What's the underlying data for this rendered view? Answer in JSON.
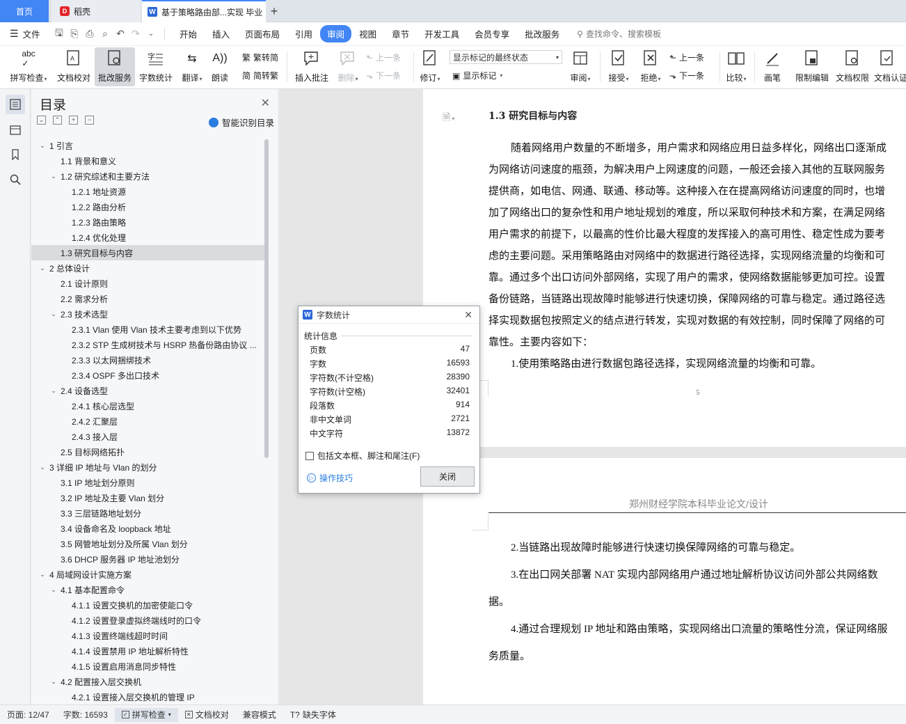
{
  "tabs": {
    "home": "首页",
    "daoke": "稻壳",
    "doc": "基于策略路由部...实现 毕业论"
  },
  "menubar": {
    "file": "文件",
    "items": [
      "开始",
      "插入",
      "页面布局",
      "引用",
      "审阅",
      "视图",
      "章节",
      "开发工具",
      "会员专享",
      "批改服务"
    ],
    "active": "审阅",
    "search": "查找命令、搜索模板"
  },
  "ribbon": {
    "spell": "拼写检查",
    "proofread": "文档校对",
    "revise_service": "批改服务",
    "word_count": "字数统计",
    "translate": "翻译",
    "read_aloud": "朗读",
    "to_traditional": "繁转简",
    "to_simplified": "简转繁",
    "insert_comment": "插入批注",
    "delete": "删除",
    "prev": "上一条",
    "next": "下一条",
    "revise": "修订",
    "markup_state": "显示标记的最终状态",
    "show_markup": "显示标记",
    "review": "审阅",
    "accept": "接受",
    "reject": "拒绝",
    "prev2": "上一条",
    "next2": "下一条",
    "compare": "比较",
    "pen": "画笔",
    "restrict_edit": "限制编辑",
    "doc_permission": "文档权限",
    "doc_auth": "文档认证"
  },
  "toc": {
    "title": "目录",
    "smart": "智能识别目录",
    "items": [
      {
        "level": 1,
        "text": "1 引言",
        "toggle": "v"
      },
      {
        "level": 2,
        "text": "1.1 背景和意义",
        "toggle": ""
      },
      {
        "level": 2,
        "text": "1.2 研究综述和主要方法",
        "toggle": "v"
      },
      {
        "level": 3,
        "text": "1.2.1 地址资源",
        "toggle": ""
      },
      {
        "level": 3,
        "text": "1.2.2 路由分析",
        "toggle": ""
      },
      {
        "level": 3,
        "text": "1.2.3 路由策略",
        "toggle": ""
      },
      {
        "level": 3,
        "text": "1.2.4 优化处理",
        "toggle": ""
      },
      {
        "level": 2,
        "text": "1.3 研究目标与内容",
        "toggle": "",
        "selected": true
      },
      {
        "level": 1,
        "text": "2 总体设计",
        "toggle": "v"
      },
      {
        "level": 2,
        "text": "2.1 设计原则",
        "toggle": ""
      },
      {
        "level": 2,
        "text": "2.2 需求分析",
        "toggle": ""
      },
      {
        "level": 2,
        "text": "2.3 技术选型",
        "toggle": "v"
      },
      {
        "level": 3,
        "text": "2.3.1 Vlan  使用 Vlan 技术主要考虑到以下优势",
        "toggle": ""
      },
      {
        "level": 3,
        "text": "2.3.2 STP 生成树技术与 HSRP 热备份路由协议 ...",
        "toggle": ""
      },
      {
        "level": 3,
        "text": "2.3.3 以太网捆绑技术",
        "toggle": ""
      },
      {
        "level": 3,
        "text": "2.3.4 OSPF 多出口技术",
        "toggle": ""
      },
      {
        "level": 2,
        "text": "2.4 设备选型",
        "toggle": "v"
      },
      {
        "level": 3,
        "text": "2.4.1 核心层选型",
        "toggle": ""
      },
      {
        "level": 3,
        "text": "2.4.2 汇聚层",
        "toggle": ""
      },
      {
        "level": 3,
        "text": "2.4.3 接入层",
        "toggle": ""
      },
      {
        "level": 2,
        "text": "2.5 目标网络拓扑",
        "toggle": ""
      },
      {
        "level": 1,
        "text": "3 详细 IP 地址与 Vlan 的划分",
        "toggle": "v"
      },
      {
        "level": 2,
        "text": "3.1 IP 地址划分原则",
        "toggle": ""
      },
      {
        "level": 2,
        "text": "3.2 IP 地址及主要 Vlan 划分",
        "toggle": ""
      },
      {
        "level": 2,
        "text": "3.3 三层链路地址划分",
        "toggle": ""
      },
      {
        "level": 2,
        "text": "3.4 设备命名及 loopback 地址",
        "toggle": ""
      },
      {
        "level": 2,
        "text": "3.5 网管地址划分及所属 Vlan 划分",
        "toggle": ""
      },
      {
        "level": 2,
        "text": "3.6 DHCP 服务器 IP 地址池划分",
        "toggle": ""
      },
      {
        "level": 1,
        "text": "4 局域网设计实施方案",
        "toggle": "v"
      },
      {
        "level": 2,
        "text": "4.1 基本配置命令",
        "toggle": "v"
      },
      {
        "level": 3,
        "text": "4.1.1 设置交换机的加密使能口令",
        "toggle": ""
      },
      {
        "level": 3,
        "text": "4.1.2 设置登录虚拟终端线时的口令",
        "toggle": ""
      },
      {
        "level": 3,
        "text": "4.1.3 设置终端线超时时间",
        "toggle": ""
      },
      {
        "level": 3,
        "text": "4.1.4 设置禁用 IP 地址解析特性",
        "toggle": ""
      },
      {
        "level": 3,
        "text": "4.1.5 设置启用消息同步特性",
        "toggle": ""
      },
      {
        "level": 2,
        "text": "4.2 配置接入层交换机",
        "toggle": "v"
      },
      {
        "level": 3,
        "text": "4.2.1 设置接入层交换机的管理 IP",
        "toggle": ""
      }
    ]
  },
  "document": {
    "heading": "1.3 研究目标与内容",
    "page1_lines": [
      {
        "text": "随着网络用户数量的不断增多，用户需求和网络应用日益多样化，网络出口逐渐成",
        "indent": true
      },
      {
        "text": "为网络访问速度的瓶颈，为解决用户上网速度的问题，一般还会接入其他的互联网服务",
        "indent": false
      },
      {
        "text": "提供商，如电信、网通、联通、移动等。这种接入在在提高网络访问速度的同时，也增",
        "indent": false
      },
      {
        "text": "加了网络出口的复杂性和用户地址规划的难度，所以采取何种技术和方案，在满足网络",
        "indent": false
      },
      {
        "text": "用户需求的前提下，以最高的性价比最大程度的发挥接入的高可用性、稳定性成为要考",
        "indent": false
      },
      {
        "text": "虑的主要问题。采用策略路由对网络中的数据进行路径选择，实现网络流量的均衡和可",
        "indent": false
      },
      {
        "text": "靠。通过多个出口访问外部网络，实现了用户的需求，使网络数据能够更加可控。设置",
        "indent": false
      },
      {
        "text": "备份链路，当链路出现故障时能够进行快速切换，保障网络的可靠与稳定。通过路径选",
        "indent": false
      },
      {
        "text": "择实现数据包按照定义的结点进行转发，实现对数据的有效控制，同时保障了网络的可",
        "indent": false
      },
      {
        "text": "靠性。主要内容如下：",
        "indent": false
      },
      {
        "text": "1.使用策略路由进行数据包路径选择，实现网络流量的均衡和可靠。",
        "indent": true
      }
    ],
    "page_number": "5",
    "page2_header": "郑州财经学院本科毕业论文/设计",
    "page2_lines": [
      {
        "text": "2.当链路出现故障时能够进行快速切换保障网络的可靠与稳定。",
        "indent": true
      },
      {
        "text": "3.在出口网关部署 NAT 实现内部网络用户通过地址解析协议访问外部公共网络数",
        "indent": true
      },
      {
        "text": "据。",
        "indent": false
      },
      {
        "text": "4.通过合理规划 IP 地址和路由策略，实现网络出口流量的策略性分流，保证网络服",
        "indent": true
      },
      {
        "text": "务质量。",
        "indent": false
      }
    ]
  },
  "dialog": {
    "title": "字数统计",
    "section": "统计信息",
    "rows": [
      {
        "label": "页数",
        "value": "47"
      },
      {
        "label": "字数",
        "value": "16593"
      },
      {
        "label": "字符数(不计空格)",
        "value": "28390"
      },
      {
        "label": "字符数(计空格)",
        "value": "32401"
      },
      {
        "label": "段落数",
        "value": "914"
      },
      {
        "label": "非中文单词",
        "value": "2721"
      },
      {
        "label": "中文字符",
        "value": "13872"
      }
    ],
    "checkbox": "包括文本框、脚注和尾注(F)",
    "tips": "操作技巧",
    "close": "关闭"
  },
  "statusbar": {
    "page": "页面: 12/47",
    "words": "字数: 16593",
    "spell": "拼写检查",
    "proof": "文档校对",
    "compat": "兼容模式",
    "missing_font": "缺失字体"
  },
  "colors": {
    "accent": "#4285f4",
    "wps_red": "#e3262b",
    "link": "#2a7de1"
  }
}
